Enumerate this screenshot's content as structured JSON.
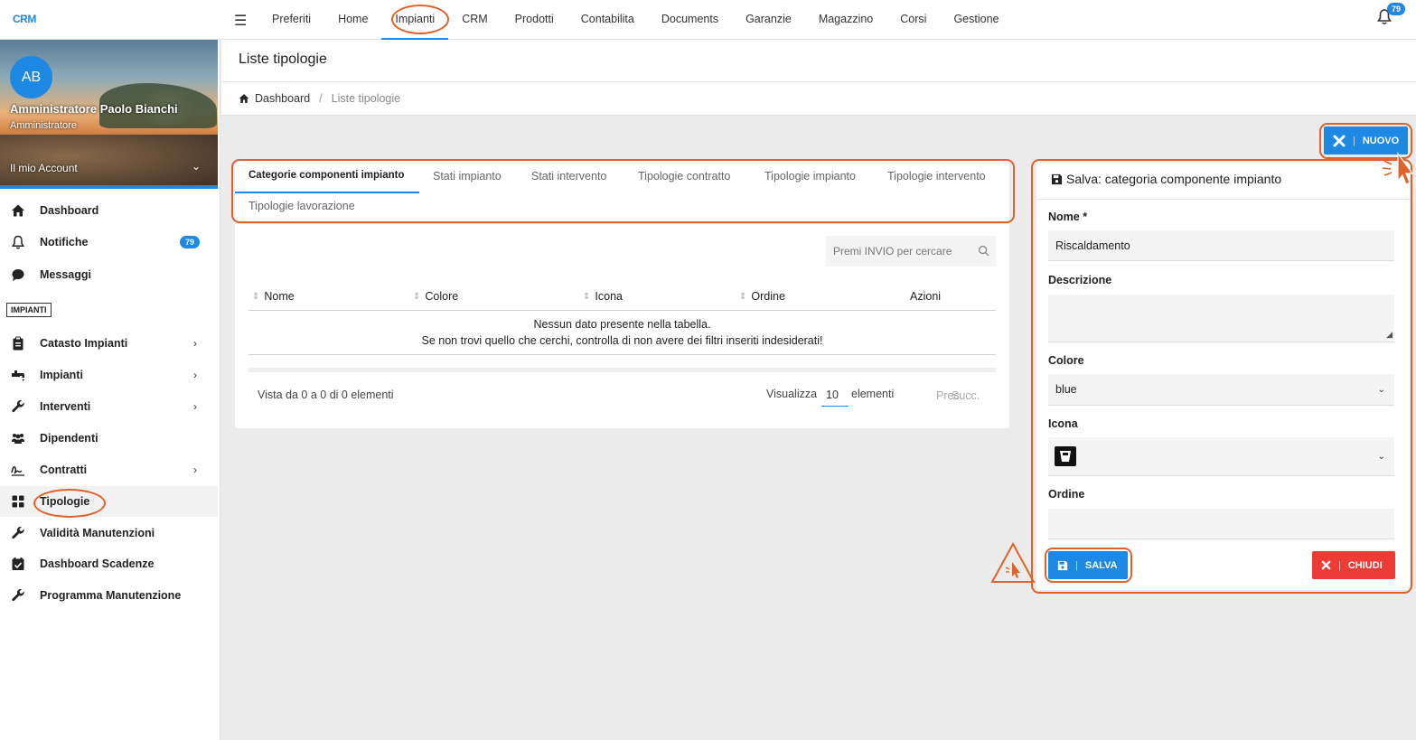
{
  "app": {
    "logo": "CRM",
    "notifications_count": "79"
  },
  "topmenu": [
    {
      "label": "Preferiti"
    },
    {
      "label": "Home"
    },
    {
      "label": "Impianti"
    },
    {
      "label": "CRM"
    },
    {
      "label": "Prodotti"
    },
    {
      "label": "Contabilita"
    },
    {
      "label": "Documents"
    },
    {
      "label": "Garanzie"
    },
    {
      "label": "Magazzino"
    },
    {
      "label": "Corsi"
    },
    {
      "label": "Gestione"
    }
  ],
  "profile": {
    "initials": "AB",
    "name": "Amministratore Paolo Bianchi",
    "role": "Amministratore",
    "account_label": "Il mio Account"
  },
  "sidebar": {
    "items": [
      {
        "label": "Dashboard",
        "icon": "home-icon"
      },
      {
        "label": "Notifiche",
        "icon": "bell-icon",
        "badge": "79"
      },
      {
        "label": "Messaggi",
        "icon": "chat-icon"
      },
      {
        "label": "Catasto Impianti",
        "icon": "clipboard-icon"
      },
      {
        "label": "Impianti",
        "icon": "faucet-icon"
      },
      {
        "label": "Interventi",
        "icon": "wrench-icon"
      },
      {
        "label": "Dipendenti",
        "icon": "users-icon"
      },
      {
        "label": "Contratti",
        "icon": "signature-icon"
      },
      {
        "label": "Tipologie",
        "icon": "grid-icon"
      },
      {
        "label": "Validità Manutenzioni",
        "icon": "wrench-icon"
      },
      {
        "label": "Dashboard Scadenze",
        "icon": "calendar-check-icon"
      },
      {
        "label": "Programma Manutenzione",
        "icon": "wrench-icon"
      }
    ],
    "section_label": "IMPIANTI"
  },
  "page": {
    "title": "Liste tipologie",
    "breadcrumb": {
      "home": "Dashboard",
      "current": "Liste tipologie"
    }
  },
  "buttons": {
    "nuovo": "NUOVO",
    "salva": "SALVA",
    "chiudi": "CHIUDI"
  },
  "tabs": [
    {
      "label": "Categorie componenti impianto"
    },
    {
      "label": "Stati impianto"
    },
    {
      "label": "Stati intervento"
    },
    {
      "label": "Tipologie contratto"
    },
    {
      "label": "Tipologie impianto"
    },
    {
      "label": "Tipologie intervento"
    },
    {
      "label": "Tipologie lavorazione"
    }
  ],
  "table": {
    "search_placeholder": "Premi INVIO per cercare",
    "columns": [
      "Nome",
      "Colore",
      "Icona",
      "Ordine",
      "Azioni"
    ],
    "empty_line1": "Nessun dato presente nella tabella.",
    "empty_line2": "Se non trovi quello che cerchi, controlla di non avere dei filtri inseriti indesiderati!",
    "info": "Vista da 0 a 0 di 0 elementi",
    "show_label": "Visualizza",
    "page_length": "10",
    "elements_label": "elementi",
    "prev": "Prec.",
    "next": "Succ."
  },
  "form": {
    "title": "Salva: categoria componente impianto",
    "nome_label": "Nome *",
    "nome_value": "Riscaldamento",
    "descrizione_label": "Descrizione",
    "descrizione_value": "",
    "colore_label": "Colore",
    "colore_value": "blue",
    "icona_label": "Icona",
    "icona_value": "bucket-icon",
    "ordine_label": "Ordine",
    "ordine_value": ""
  },
  "colors": {
    "accent": "#1e88e5",
    "danger": "#ef3b36",
    "annotation": "#e0622a"
  }
}
